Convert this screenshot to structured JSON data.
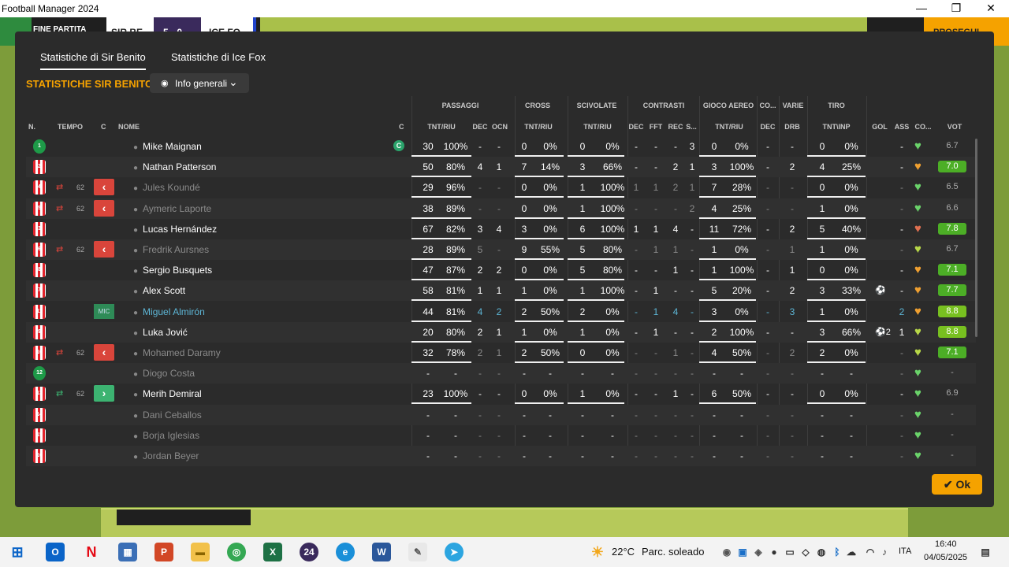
{
  "window": {
    "title": "Football Manager 2024",
    "min": "—",
    "max": "❐",
    "close": "✕"
  },
  "gamebar": {
    "end_label": "FINE PARTITA",
    "team1": "SIR BE",
    "score": "5 - 0",
    "team2": "ICE FO",
    "continue_label": "PROSEGUI"
  },
  "tabs": [
    {
      "label": "Statistiche di Sir Benito"
    },
    {
      "label": "Statistiche di Ice Fox"
    }
  ],
  "section_title": "STATISTICHE SIR BENITO",
  "view_button": {
    "label": "Info generali"
  },
  "group_headers": {
    "passaggi": "PASSAGGI",
    "cross": "CROSS",
    "scivolate": "SCIVOLATE",
    "contrasti": "CONTRASTI",
    "gioco_aereo": "GIOCO AEREO",
    "co": "CO...",
    "varie": "VARIE",
    "tiro": "TIRO"
  },
  "col_headers": {
    "n": "N.",
    "tempo": "TEMPO",
    "c": "C",
    "nome": "NOME",
    "c2": "C",
    "pass_tr": "TNT/RIU",
    "pass_dec": "DEC",
    "pass_ocn": "OCN",
    "cross_tr": "TNT/RIU",
    "sciv_tr": "TNT/RIU",
    "cont_dec": "DEC",
    "cont_fft": "FFT",
    "cont_rec": "REC",
    "cont_s": "S...",
    "aereo_tr": "TNT/RIU",
    "co_dec": "DEC",
    "varie_drb": "DRB",
    "tiro_tr": "TNT\\INP",
    "gol": "GOL",
    "ass": "ASS",
    "cond": "CO...",
    "voto": "VOT"
  },
  "players": [
    {
      "n": "1",
      "gk": true,
      "sub": "",
      "time": "",
      "badge": "",
      "name": "Mike Maignan",
      "dimmed": false,
      "captain": "C",
      "pt": "30",
      "pr": "100%",
      "pdec": "-",
      "pocn": "-",
      "ct": "0",
      "cr": "0%",
      "st": "0",
      "sr": "0%",
      "cdec": "-",
      "cfft": "-",
      "crec": "-",
      "cs": "3",
      "at": "0",
      "ar": "0%",
      "codec": "-",
      "drb": "-",
      "tt": "0",
      "tr": "0%",
      "gol": "",
      "ass": "-",
      "heart": "#6ad36a",
      "voto": "6.7",
      "vstyle": "plain"
    },
    {
      "n": "2",
      "gk": false,
      "sub": "",
      "time": "",
      "badge": "",
      "name": "Nathan Patterson",
      "dimmed": false,
      "captain": "",
      "pt": "50",
      "pr": "80%",
      "pdec": "4",
      "pocn": "1",
      "ct": "7",
      "cr": "14%",
      "st": "3",
      "sr": "66%",
      "cdec": "-",
      "cfft": "-",
      "crec": "2",
      "cs": "1",
      "at": "3",
      "ar": "100%",
      "codec": "-",
      "drb": "2",
      "tt": "4",
      "tr": "25%",
      "gol": "",
      "ass": "-",
      "heart": "#f0a030",
      "voto": "7.0",
      "vstyle": "green"
    },
    {
      "n": "4",
      "gk": false,
      "sub": "out",
      "time": "62",
      "badge": "out",
      "name": "Jules Koundé",
      "dimmed": true,
      "captain": "",
      "pt": "29",
      "pr": "96%",
      "pdec": "-",
      "pocn": "-",
      "ct": "0",
      "cr": "0%",
      "st": "1",
      "sr": "100%",
      "cdec": "1",
      "cfft": "1",
      "crec": "2",
      "cs": "1",
      "at": "7",
      "ar": "28%",
      "codec": "-",
      "drb": "-",
      "tt": "0",
      "tr": "0%",
      "gol": "",
      "ass": "-",
      "heart": "#6ad36a",
      "voto": "6.5",
      "vstyle": "plain"
    },
    {
      "n": "5",
      "gk": false,
      "sub": "out",
      "time": "62",
      "badge": "out",
      "name": "Aymeric Laporte",
      "dimmed": true,
      "captain": "",
      "pt": "38",
      "pr": "89%",
      "pdec": "-",
      "pocn": "-",
      "ct": "0",
      "cr": "0%",
      "st": "1",
      "sr": "100%",
      "cdec": "-",
      "cfft": "-",
      "crec": "-",
      "cs": "2",
      "at": "4",
      "ar": "25%",
      "codec": "-",
      "drb": "-",
      "tt": "1",
      "tr": "0%",
      "gol": "",
      "ass": "-",
      "heart": "#6ad36a",
      "voto": "6.6",
      "vstyle": "plain"
    },
    {
      "n": "3",
      "gk": false,
      "sub": "",
      "time": "",
      "badge": "",
      "name": "Lucas Hernández",
      "dimmed": false,
      "captain": "",
      "pt": "67",
      "pr": "82%",
      "pdec": "3",
      "pocn": "4",
      "ct": "3",
      "cr": "0%",
      "st": "6",
      "sr": "100%",
      "cdec": "1",
      "cfft": "1",
      "crec": "4",
      "cs": "-",
      "at": "11",
      "ar": "72%",
      "codec": "-",
      "drb": "2",
      "tt": "5",
      "tr": "40%",
      "gol": "",
      "ass": "-",
      "heart": "#e07050",
      "voto": "7.8",
      "vstyle": "green"
    },
    {
      "n": "6",
      "gk": false,
      "sub": "out",
      "time": "62",
      "badge": "out",
      "name": "Fredrik Aursnes",
      "dimmed": true,
      "captain": "",
      "pt": "28",
      "pr": "89%",
      "pdec": "5",
      "pocn": "-",
      "ct": "9",
      "cr": "55%",
      "st": "5",
      "sr": "80%",
      "cdec": "-",
      "cfft": "1",
      "crec": "1",
      "cs": "-",
      "at": "1",
      "ar": "0%",
      "codec": "-",
      "drb": "1",
      "tt": "1",
      "tr": "0%",
      "gol": "",
      "ass": "-",
      "heart": "#b8d848",
      "voto": "6.7",
      "vstyle": "plain"
    },
    {
      "n": "8",
      "gk": false,
      "sub": "",
      "time": "",
      "badge": "",
      "name": "Sergio Busquets",
      "dimmed": false,
      "captain": "",
      "pt": "47",
      "pr": "87%",
      "pdec": "2",
      "pocn": "2",
      "ct": "0",
      "cr": "0%",
      "st": "5",
      "sr": "80%",
      "cdec": "-",
      "cfft": "-",
      "crec": "1",
      "cs": "-",
      "at": "1",
      "ar": "100%",
      "codec": "-",
      "drb": "1",
      "tt": "0",
      "tr": "0%",
      "gol": "",
      "ass": "-",
      "heart": "#f0a030",
      "voto": "7.1",
      "vstyle": "green"
    },
    {
      "n": "7",
      "gk": false,
      "sub": "",
      "time": "",
      "badge": "",
      "name": "Alex Scott",
      "dimmed": false,
      "captain": "",
      "pt": "58",
      "pr": "81%",
      "pdec": "1",
      "pocn": "1",
      "ct": "1",
      "cr": "0%",
      "st": "1",
      "sr": "100%",
      "cdec": "-",
      "cfft": "1",
      "crec": "-",
      "cs": "-",
      "at": "5",
      "ar": "20%",
      "codec": "-",
      "drb": "2",
      "tt": "3",
      "tr": "33%",
      "gol": "⚽",
      "ass": "-",
      "heart": "#f0a030",
      "voto": "7.7",
      "vstyle": "green"
    },
    {
      "n": "11",
      "gk": false,
      "sub": "",
      "time": "",
      "badge": "mic",
      "name": "Miguel Almirón",
      "dimmed": false,
      "blue": true,
      "captain": "",
      "pt": "44",
      "pr": "81%",
      "pdec": "4",
      "pocn": "2",
      "ct": "2",
      "cr": "50%",
      "st": "2",
      "sr": "0%",
      "cdec": "-",
      "cfft": "1",
      "crec": "4",
      "cs": "-",
      "at": "3",
      "ar": "0%",
      "codec": "-",
      "drb": "3",
      "tt": "1",
      "tr": "0%",
      "gol": "",
      "ass": "2",
      "heart": "#f0a030",
      "voto": "8.8",
      "vstyle": "lime"
    },
    {
      "n": "9",
      "gk": false,
      "sub": "",
      "time": "",
      "badge": "",
      "name": "Luka Jović",
      "dimmed": false,
      "captain": "",
      "pt": "20",
      "pr": "80%",
      "pdec": "2",
      "pocn": "1",
      "ct": "1",
      "cr": "0%",
      "st": "1",
      "sr": "0%",
      "cdec": "-",
      "cfft": "1",
      "crec": "-",
      "cs": "-",
      "at": "2",
      "ar": "100%",
      "codec": "-",
      "drb": "-",
      "tt": "3",
      "tr": "66%",
      "gol": "⚽2",
      "ass": "1",
      "heart": "#b8d848",
      "voto": "8.8",
      "vstyle": "lime"
    },
    {
      "n": "10",
      "gk": false,
      "sub": "out",
      "time": "62",
      "badge": "out",
      "name": "Mohamed Daramy",
      "dimmed": true,
      "captain": "",
      "pt": "32",
      "pr": "78%",
      "pdec": "2",
      "pocn": "1",
      "ct": "2",
      "cr": "50%",
      "st": "0",
      "sr": "0%",
      "cdec": "-",
      "cfft": "-",
      "crec": "1",
      "cs": "-",
      "at": "4",
      "ar": "50%",
      "codec": "-",
      "drb": "2",
      "tt": "2",
      "tr": "0%",
      "gol": "",
      "ass": "-",
      "heart": "#b8d848",
      "voto": "7.1",
      "vstyle": "green"
    },
    {
      "n": "12",
      "gk": true,
      "sub": "",
      "time": "",
      "badge": "",
      "name": "Diogo Costa",
      "dimmed": true,
      "captain": "",
      "pt": "-",
      "pr": "-",
      "pdec": "-",
      "pocn": "-",
      "ct": "-",
      "cr": "-",
      "st": "-",
      "sr": "-",
      "cdec": "-",
      "cfft": "-",
      "crec": "-",
      "cs": "-",
      "at": "-",
      "ar": "-",
      "codec": "-",
      "drb": "-",
      "tt": "-",
      "tr": "-",
      "gol": "",
      "ass": "-",
      "heart": "#6ad36a",
      "voto": "-",
      "vstyle": "plain"
    },
    {
      "n": "13",
      "gk": false,
      "sub": "in",
      "time": "62",
      "badge": "in",
      "name": "Merih Demiral",
      "dimmed": false,
      "captain": "",
      "pt": "23",
      "pr": "100%",
      "pdec": "-",
      "pocn": "-",
      "ct": "0",
      "cr": "0%",
      "st": "1",
      "sr": "0%",
      "cdec": "-",
      "cfft": "-",
      "crec": "1",
      "cs": "-",
      "at": "6",
      "ar": "50%",
      "codec": "-",
      "drb": "-",
      "tt": "0",
      "tr": "0%",
      "gol": "",
      "ass": "-",
      "heart": "#6ad36a",
      "voto": "6.9",
      "vstyle": "plain"
    },
    {
      "n": "14",
      "gk": false,
      "sub": "",
      "time": "",
      "badge": "",
      "name": "Dani Ceballos",
      "dimmed": true,
      "captain": "",
      "pt": "-",
      "pr": "-",
      "pdec": "-",
      "pocn": "-",
      "ct": "-",
      "cr": "-",
      "st": "-",
      "sr": "-",
      "cdec": "-",
      "cfft": "-",
      "crec": "-",
      "cs": "-",
      "at": "-",
      "ar": "-",
      "codec": "-",
      "drb": "-",
      "tt": "-",
      "tr": "-",
      "gol": "",
      "ass": "-",
      "heart": "#6ad36a",
      "voto": "-",
      "vstyle": "plain"
    },
    {
      "n": "15",
      "gk": false,
      "sub": "",
      "time": "",
      "badge": "",
      "name": "Borja Iglesias",
      "dimmed": true,
      "captain": "",
      "pt": "-",
      "pr": "-",
      "pdec": "-",
      "pocn": "-",
      "ct": "-",
      "cr": "-",
      "st": "-",
      "sr": "-",
      "cdec": "-",
      "cfft": "-",
      "crec": "-",
      "cs": "-",
      "at": "-",
      "ar": "-",
      "codec": "-",
      "drb": "-",
      "tt": "-",
      "tr": "-",
      "gol": "",
      "ass": "-",
      "heart": "#6ad36a",
      "voto": "-",
      "vstyle": "plain"
    },
    {
      "n": "16",
      "gk": false,
      "sub": "",
      "time": "",
      "badge": "",
      "name": "Jordan Beyer",
      "dimmed": true,
      "captain": "",
      "pt": "-",
      "pr": "-",
      "pdec": "-",
      "pocn": "-",
      "ct": "-",
      "cr": "-",
      "st": "-",
      "sr": "-",
      "cdec": "-",
      "cfft": "-",
      "crec": "-",
      "cs": "-",
      "at": "-",
      "ar": "-",
      "codec": "-",
      "drb": "-",
      "tt": "-",
      "tr": "-",
      "gol": "",
      "ass": "-",
      "heart": "#6ad36a",
      "voto": "-",
      "vstyle": "plain"
    }
  ],
  "ok_button": {
    "label": "Ok"
  },
  "taskbar": {
    "weather_temp": "22°C",
    "weather_desc": "Parc. soleado",
    "lang": "ITA",
    "time": "16:40",
    "date": "04/05/2025"
  }
}
